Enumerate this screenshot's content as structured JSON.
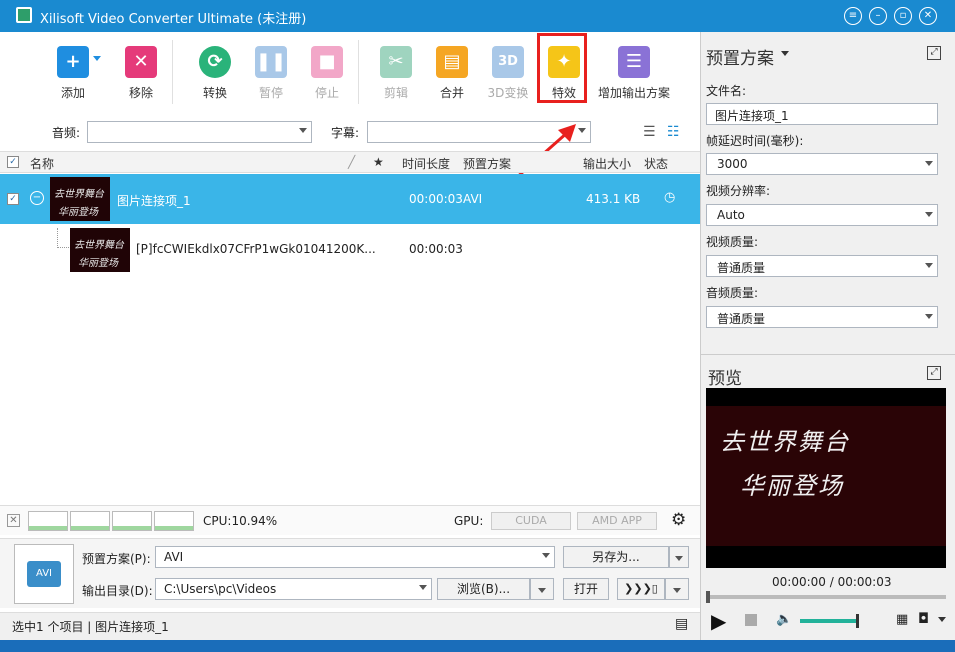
{
  "window": {
    "title": "Xilisoft Video Converter Ultimate (未注册)"
  },
  "toolbar": {
    "add": "添加",
    "remove": "移除",
    "convert": "转换",
    "pause": "暂停",
    "stop": "停止",
    "clip": "剪辑",
    "merge": "合并",
    "3d": "3D变换",
    "effects": "特效",
    "add_profile": "增加输出方案",
    "icon_3d": "3D"
  },
  "filters": {
    "audio_label": "音频:",
    "subtitle_label": "字幕:"
  },
  "columns": {
    "name": "名称",
    "star": "★",
    "duration": "时间长度",
    "profile": "预置方案",
    "size": "输出大小",
    "status": "状态"
  },
  "rows": [
    {
      "name": "图片连接项_1",
      "duration": "00:00:03",
      "profile": "AVI",
      "size": "413.1 KB",
      "thumb_line1": "去世界舞台",
      "thumb_line2": "华丽登场"
    },
    {
      "name": "[P]fcCWIEkdlx07CFrP1wGk01041200K...",
      "duration": "00:00:03",
      "thumb_line1": "去世界舞台",
      "thumb_line2": "华丽登场"
    }
  ],
  "stats": {
    "cpu": "CPU:10.94%",
    "gpu_label": "GPU:",
    "cuda": "CUDA",
    "amd": "AMD APP"
  },
  "bottom": {
    "profile_label": "预置方案(P):",
    "profile_value": "AVI",
    "save_as": "另存为...",
    "output_label": "输出目录(D):",
    "output_value": "C:\\Users\\pc\\Videos",
    "browse": "浏览(B)...",
    "open": "打开",
    "profile_icon_text": "AVI"
  },
  "status": {
    "text": "选中1 个项目 | 图片连接项_1"
  },
  "right": {
    "title": "预置方案",
    "filename_label": "文件名:",
    "filename_value": "图片连接项_1",
    "delay_label": "帧延迟时间(毫秒):",
    "delay_value": "3000",
    "resolution_label": "视频分辨率:",
    "resolution_value": "Auto",
    "vquality_label": "视频质量:",
    "vquality_value": "普通质量",
    "aquality_label": "音频质量:",
    "aquality_value": "普通质量",
    "preview_title": "预览",
    "preview_line1": "去世界舞台",
    "preview_line2": "华丽登场",
    "time": "00:00:00 / 00:00:03"
  },
  "colors": {
    "titlebar": "#1a8ad0",
    "selected_row": "#3ab5e8",
    "highlight": "#e8201e",
    "accent": "#22b29a"
  },
  "icons": [
    "add-icon",
    "remove-icon",
    "convert-icon",
    "pause-icon",
    "stop-icon",
    "clip-icon",
    "merge-icon",
    "3d-icon",
    "effects-icon",
    "add-profile-icon"
  ]
}
